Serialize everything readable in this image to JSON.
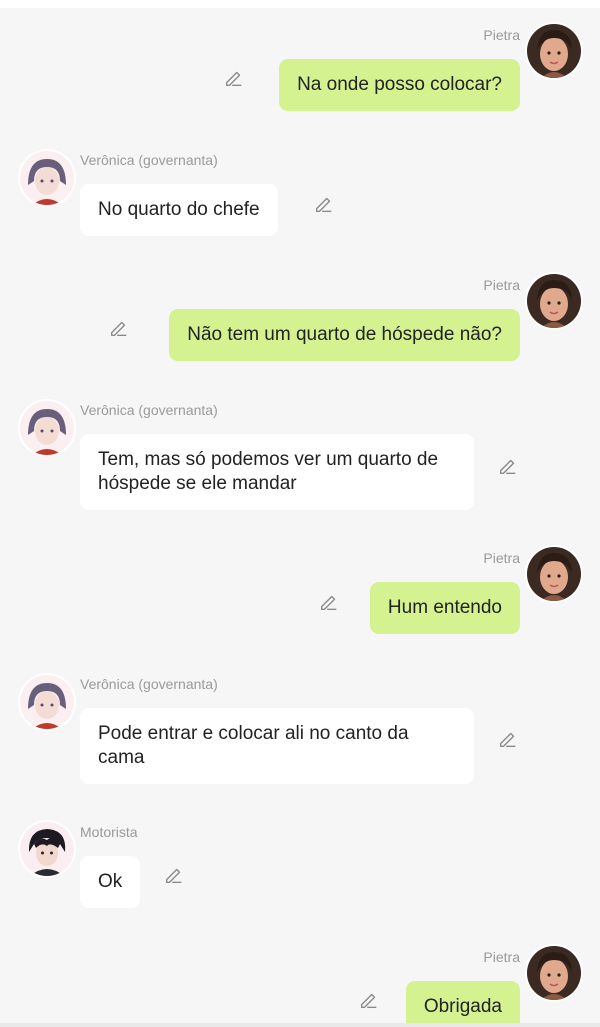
{
  "characters": {
    "user": "Pietra",
    "governess": "Verônica (governanta)",
    "driver": "Motorista"
  },
  "messages": [
    {
      "speaker": "Pietra",
      "text": "Na onde posso colocar?"
    },
    {
      "speaker": "Verônica (governanta)",
      "text": "No quarto do chefe"
    },
    {
      "speaker": "Pietra",
      "text": "Não tem um quarto de hóspede não?"
    },
    {
      "speaker": "Verônica (governanta)",
      "text": "Tem, mas só podemos ver um quarto de hóspede se ele mandar"
    },
    {
      "speaker": "Pietra",
      "text": "Hum entendo"
    },
    {
      "speaker": "Verônica (governanta)",
      "text": "Pode entrar e colocar ali no canto da cama"
    },
    {
      "speaker": "Motorista",
      "text": "Ok"
    },
    {
      "speaker": "Pietra",
      "text": "Obrigada"
    }
  ],
  "icons": {
    "edit": "pencil-icon",
    "avatar_user": "avatar-pietra",
    "avatar_governess": "avatar-veronica",
    "avatar_driver": "avatar-motorista"
  },
  "colors": {
    "background": "#f6f6f6",
    "user_bubble": "#d4f290",
    "other_bubble": "#ffffff",
    "name_text": "#9a9a9a",
    "message_text": "#222222"
  }
}
